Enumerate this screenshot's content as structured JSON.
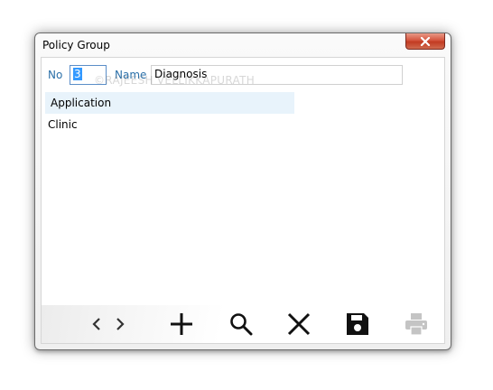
{
  "window": {
    "title": "Policy Group"
  },
  "form": {
    "no_label": "No",
    "no_value": "3",
    "name_label": "Name",
    "name_value": "Diagnosis"
  },
  "watermark": "©RAJEESH VELLIKKAPURATH",
  "list": {
    "items": [
      {
        "label": "Application",
        "selected": true
      },
      {
        "label": "Clinic",
        "selected": false
      }
    ]
  },
  "toolbar": {
    "icons": [
      "chevron-left-icon",
      "chevron-right-icon",
      "add-icon",
      "search-icon",
      "delete-icon",
      "save-icon",
      "print-icon"
    ],
    "print_enabled": false
  },
  "colors": {
    "label_blue": "#2a6fa8",
    "selection": "#e8f3fb",
    "close_red": "#c23b22"
  }
}
